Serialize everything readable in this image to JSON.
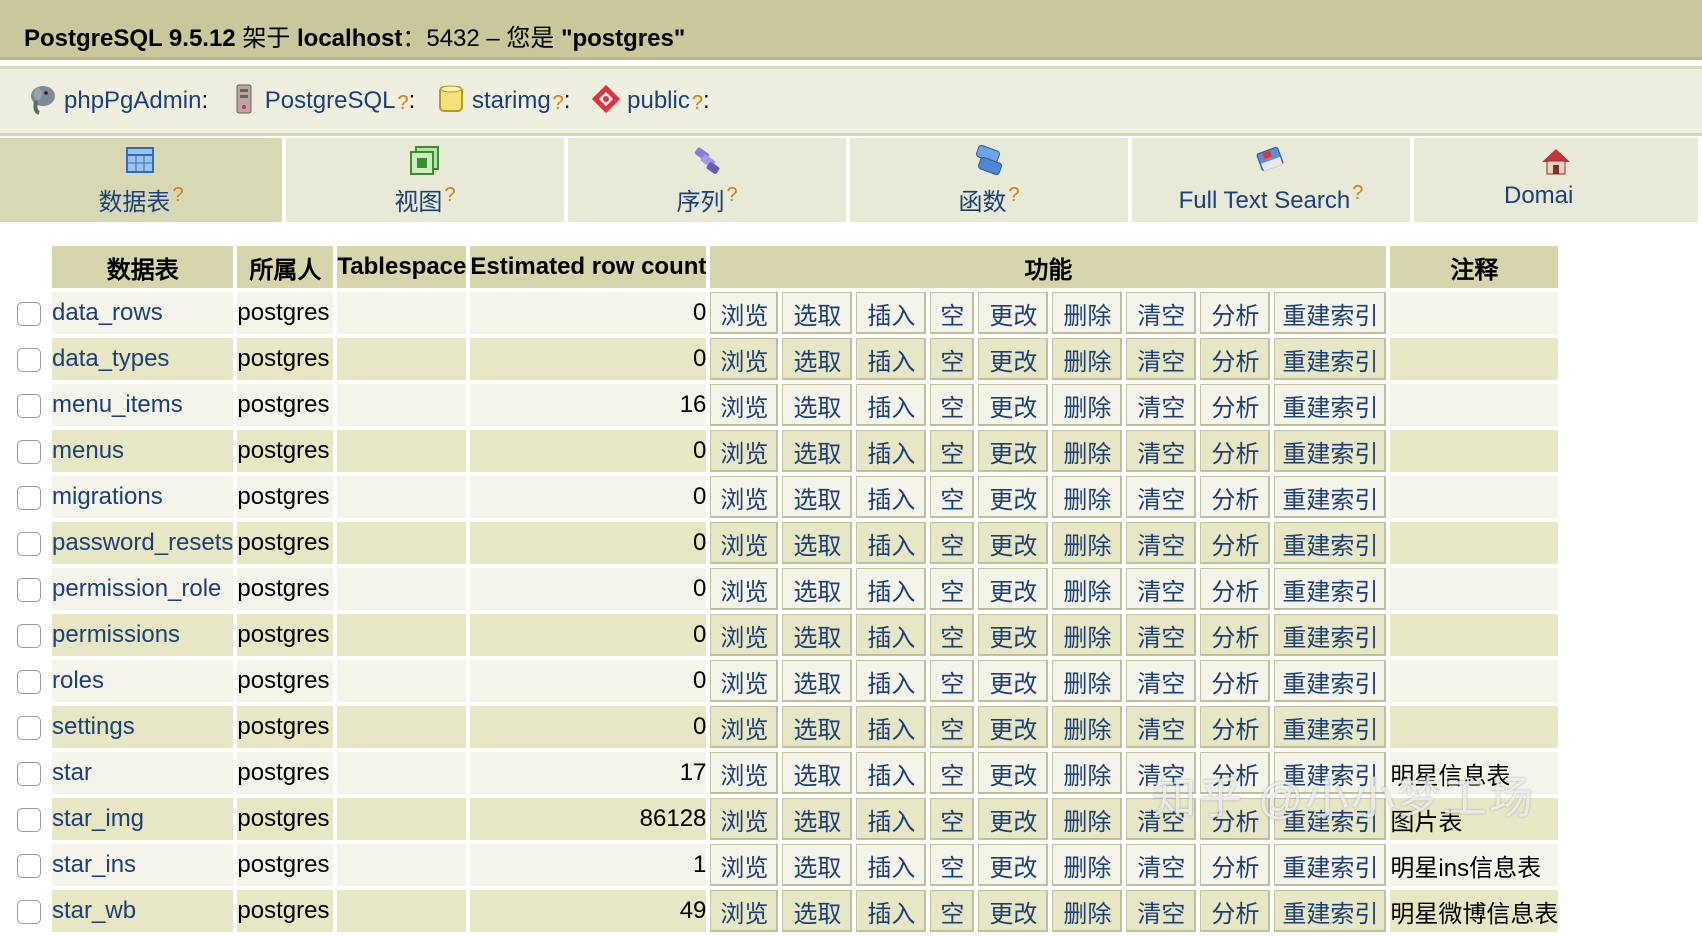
{
  "header": {
    "product": "PostgreSQL 9.5.12",
    "on": "架于",
    "host": "localhost",
    "port_sep": "：5432 – 您是",
    "user": "\"postgres\""
  },
  "breadcrumb": {
    "items": [
      {
        "label": "phpPgAdmin",
        "suffix": ":",
        "help": ""
      },
      {
        "label": "PostgreSQL",
        "suffix": ":",
        "help": "?"
      },
      {
        "label": "starimg",
        "suffix": ":",
        "help": "?"
      },
      {
        "label": "public",
        "suffix": ":",
        "help": "?"
      }
    ]
  },
  "tabs": [
    {
      "label": "数据表",
      "help": "?",
      "active": true
    },
    {
      "label": "视图",
      "help": "?"
    },
    {
      "label": "序列",
      "help": "?"
    },
    {
      "label": "函数",
      "help": "?"
    },
    {
      "label": "Full Text Search",
      "help": "?"
    },
    {
      "label": "Domai",
      "help": ""
    }
  ],
  "table": {
    "headers": {
      "name": "数据表",
      "owner": "所属人",
      "tablespace": "Tablespace",
      "rowcount": "Estimated row count",
      "actions": "功能",
      "comment": "注释"
    },
    "action_labels": [
      "浏览",
      "选取",
      "插入",
      "空",
      "更改",
      "删除",
      "清空",
      "分析",
      "重建索引"
    ],
    "rows": [
      {
        "name": "data_rows",
        "owner": "postgres",
        "tablespace": "",
        "count": "0",
        "comment": ""
      },
      {
        "name": "data_types",
        "owner": "postgres",
        "tablespace": "",
        "count": "0",
        "comment": ""
      },
      {
        "name": "menu_items",
        "owner": "postgres",
        "tablespace": "",
        "count": "16",
        "comment": ""
      },
      {
        "name": "menus",
        "owner": "postgres",
        "tablespace": "",
        "count": "0",
        "comment": ""
      },
      {
        "name": "migrations",
        "owner": "postgres",
        "tablespace": "",
        "count": "0",
        "comment": ""
      },
      {
        "name": "password_resets",
        "owner": "postgres",
        "tablespace": "",
        "count": "0",
        "comment": ""
      },
      {
        "name": "permission_role",
        "owner": "postgres",
        "tablespace": "",
        "count": "0",
        "comment": ""
      },
      {
        "name": "permissions",
        "owner": "postgres",
        "tablespace": "",
        "count": "0",
        "comment": ""
      },
      {
        "name": "roles",
        "owner": "postgres",
        "tablespace": "",
        "count": "0",
        "comment": ""
      },
      {
        "name": "settings",
        "owner": "postgres",
        "tablespace": "",
        "count": "0",
        "comment": ""
      },
      {
        "name": "star",
        "owner": "postgres",
        "tablespace": "",
        "count": "17",
        "comment": "明星信息表"
      },
      {
        "name": "star_img",
        "owner": "postgres",
        "tablespace": "",
        "count": "86128",
        "comment": "图片表"
      },
      {
        "name": "star_ins",
        "owner": "postgres",
        "tablespace": "",
        "count": "1",
        "comment": "明星ins信息表"
      },
      {
        "name": "star_wb",
        "owner": "postgres",
        "tablespace": "",
        "count": "49",
        "comment": "明星微博信息表"
      }
    ]
  },
  "watermark": "知乎 @小小梦工场",
  "icons": {
    "breadcrumb": [
      "elephant-icon",
      "server-icon",
      "database-icon",
      "schema-icon"
    ],
    "tabs": [
      "table-icon",
      "view-icon",
      "sequence-icon",
      "function-icon",
      "fulltext-icon",
      "domain-icon"
    ]
  }
}
